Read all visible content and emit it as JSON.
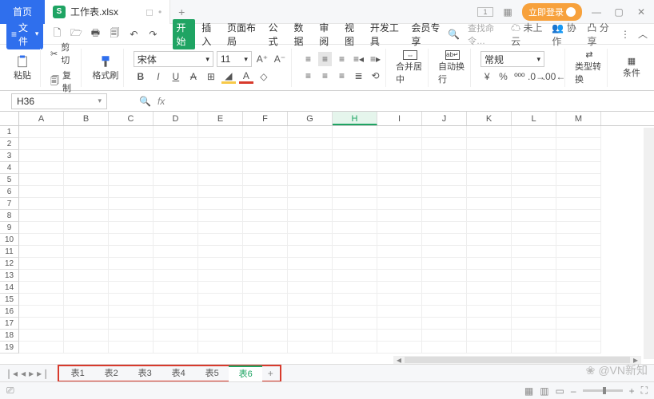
{
  "titlebar": {
    "home": "首页",
    "doc_name": "工作表.xlsx",
    "login": "立即登录"
  },
  "menubar": {
    "file": "文件",
    "tabs": [
      "开始",
      "插入",
      "页面布局",
      "公式",
      "数据",
      "审阅",
      "视图",
      "开发工具",
      "会员专享"
    ],
    "search_placeholder": "查找命令…",
    "cloud": "未上云",
    "coop": "协作",
    "share": "分享"
  },
  "ribbon": {
    "paste": "粘贴",
    "cut": "剪切",
    "copy": "复制",
    "format_painter": "格式刷",
    "font_name": "宋体",
    "font_size": "11",
    "merge": "合并居中",
    "wrap": "自动换行",
    "number_format": "常规",
    "type_convert": "类型转换",
    "cond": "条件"
  },
  "namebox": {
    "cell_ref": "H36"
  },
  "columns": [
    "A",
    "B",
    "C",
    "D",
    "E",
    "F",
    "G",
    "H",
    "I",
    "J",
    "K",
    "L",
    "M"
  ],
  "active_col": "H",
  "row_count": 19,
  "sheets": [
    "表1",
    "表2",
    "表3",
    "表4",
    "表5",
    "表6"
  ],
  "active_sheet": "表6",
  "watermark": "@VN新知"
}
